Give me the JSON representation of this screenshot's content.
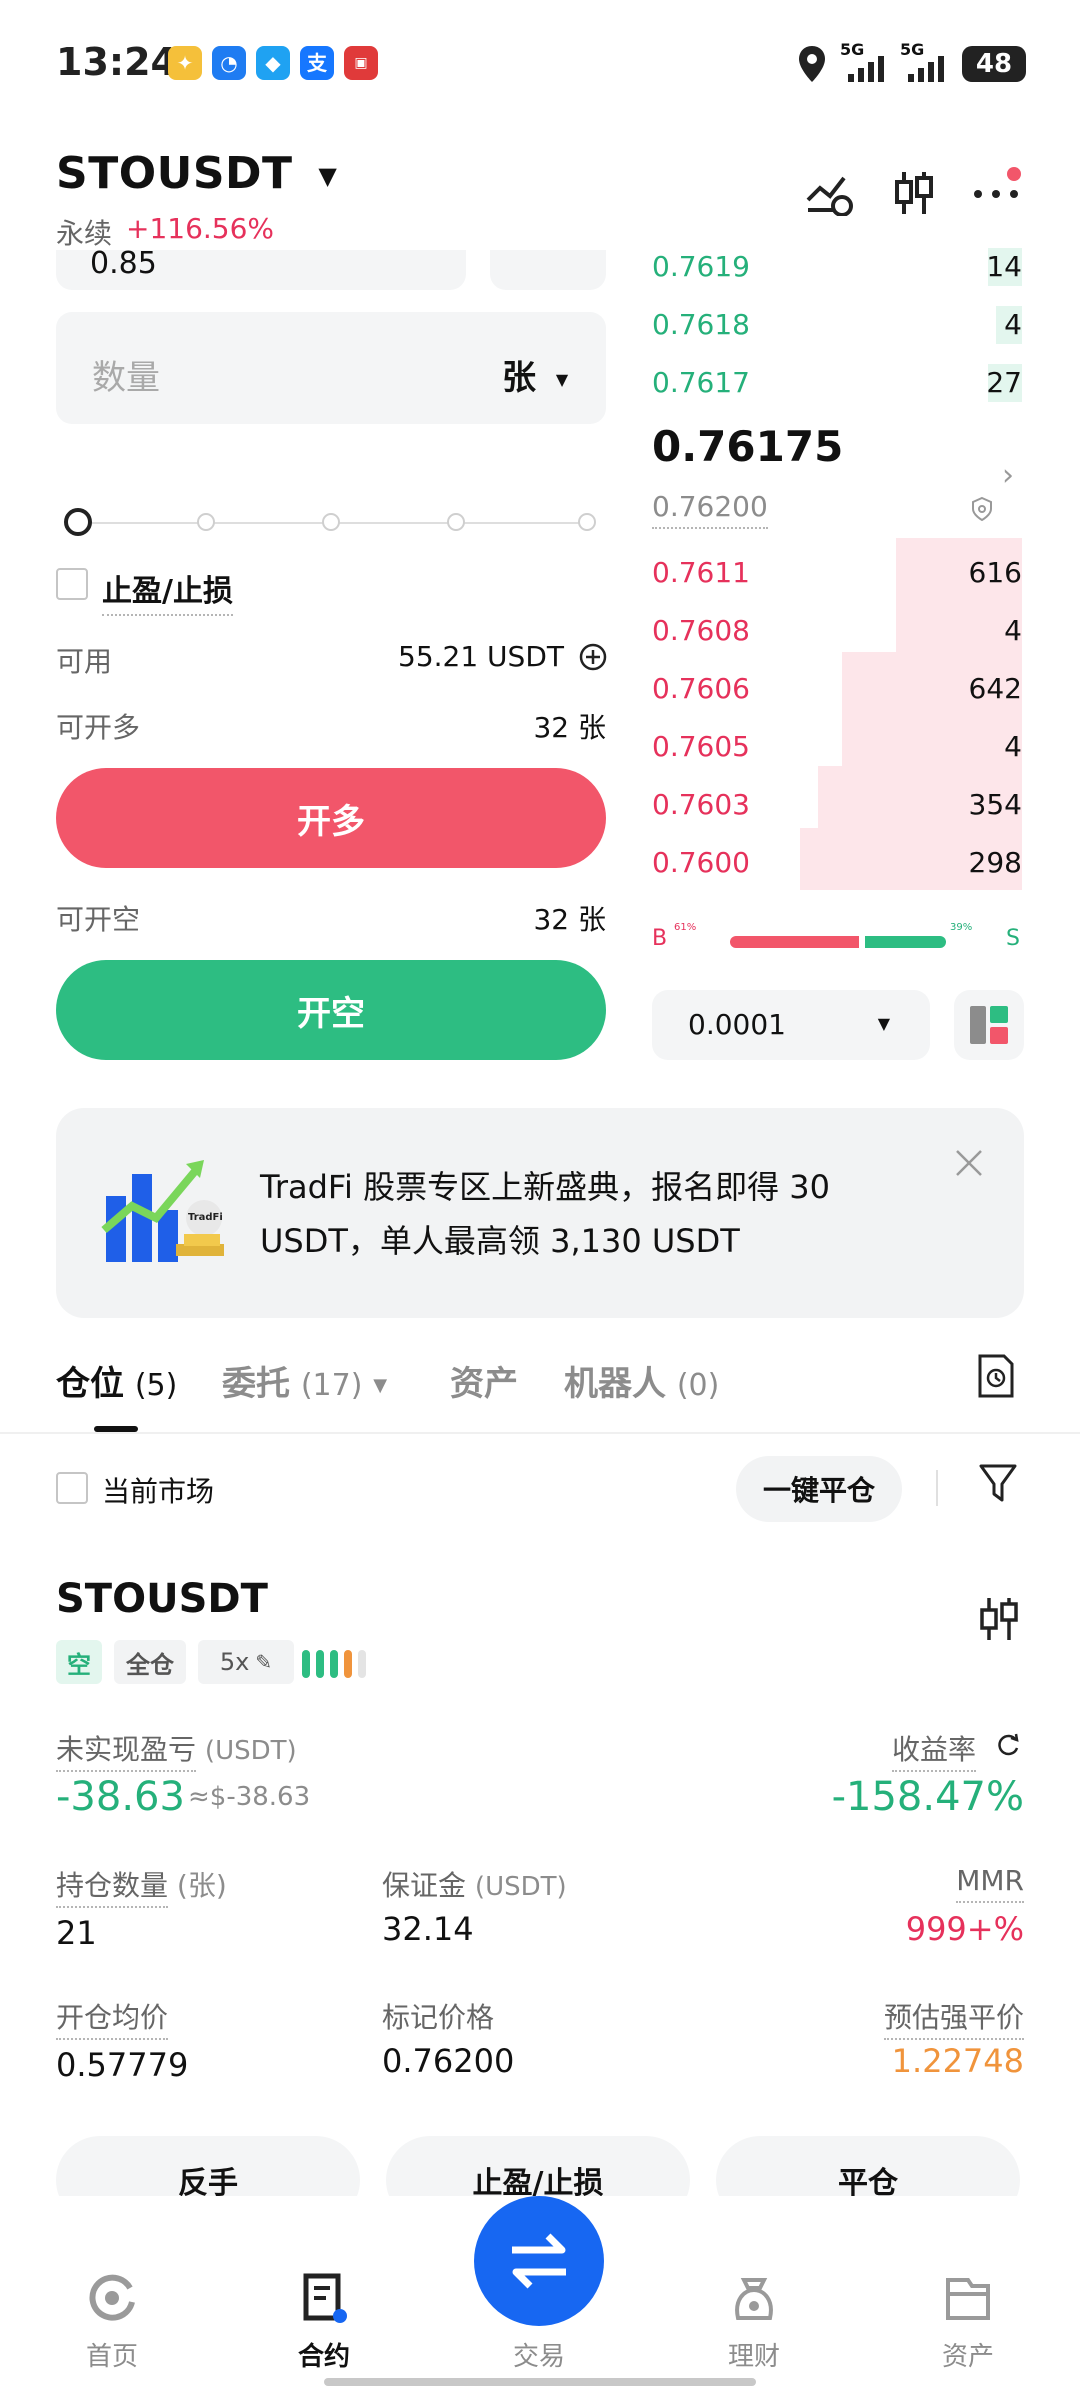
{
  "status_bar": {
    "time": "13:24",
    "network1": "5G",
    "network2": "5G",
    "battery": "48"
  },
  "header": {
    "symbol": "STOUSDT",
    "contract_type": "永续",
    "change": "+116.56%"
  },
  "order_form": {
    "price_partial": "0.85",
    "quantity_placeholder": "数量",
    "quantity_unit": "张",
    "tpsl_label": "止盈/止损",
    "available_label": "可用",
    "available_value": "55.21 USDT",
    "can_long_label": "可开多",
    "can_long_value": "32 张",
    "long_button": "开多",
    "can_short_label": "可开空",
    "can_short_value": "32 张",
    "short_button": "开空"
  },
  "order_book": {
    "asks": [
      {
        "price": "0.7619",
        "size": "14"
      },
      {
        "price": "0.7618",
        "size": "4"
      },
      {
        "price": "0.7617",
        "size": "27"
      }
    ],
    "last_price": "0.76175",
    "mark_price": "0.76200",
    "bids": [
      {
        "price": "0.7611",
        "size": "616"
      },
      {
        "price": "0.7608",
        "size": "4"
      },
      {
        "price": "0.7606",
        "size": "642"
      },
      {
        "price": "0.7605",
        "size": "4"
      },
      {
        "price": "0.7603",
        "size": "354"
      },
      {
        "price": "0.7600",
        "size": "298"
      }
    ],
    "ratio_b_label": "B",
    "ratio_b": "61%",
    "ratio_s_label": "S",
    "ratio_s": "39%",
    "buy_fraction": 0.61,
    "precision": "0.0001"
  },
  "banner": {
    "text": "TradFi 股票专区上新盛典，报名即得 30 USDT，单人最高领 3,130 USDT",
    "image_label": "TradFi"
  },
  "tabs": {
    "positions": "仓位",
    "positions_count": "(5)",
    "orders": "委托",
    "orders_count": "(17)",
    "assets": "资产",
    "bots": "机器人",
    "bots_count": "(0)"
  },
  "filter": {
    "current_market": "当前市场",
    "close_all": "一键平仓"
  },
  "position": {
    "symbol": "STOUSDT",
    "side": "空",
    "margin_mode": "全仓",
    "leverage": "5x",
    "unrealized_pnl_label": "未实现盈亏",
    "unrealized_pnl_unit": "(USDT)",
    "unrealized_pnl": "-38.63",
    "unrealized_pnl_usd": "≈$-38.63",
    "roe_label": "收益率",
    "roe": "-158.47%",
    "size_label": "持仓数量",
    "size_unit": "(张)",
    "size": "21",
    "margin_label": "保证金",
    "margin_unit": "(USDT)",
    "margin": "32.14",
    "mmr_label": "MMR",
    "mmr": "999+%",
    "entry_label": "开仓均价",
    "entry": "0.57779",
    "mark_label": "标记价格",
    "mark": "0.76200",
    "liq_label": "预估强平价",
    "liq": "1.22748"
  },
  "actions": {
    "reverse": "反手",
    "tpsl": "止盈/止损",
    "close": "平仓"
  },
  "nav": {
    "home": "首页",
    "contracts": "合约",
    "trade": "交易",
    "earn": "理财",
    "assets": "资产"
  },
  "colors": {
    "green": "#25b07a",
    "red": "#f2566a",
    "accent_blue": "#1767f2",
    "liq_orange": "#f0943c"
  }
}
